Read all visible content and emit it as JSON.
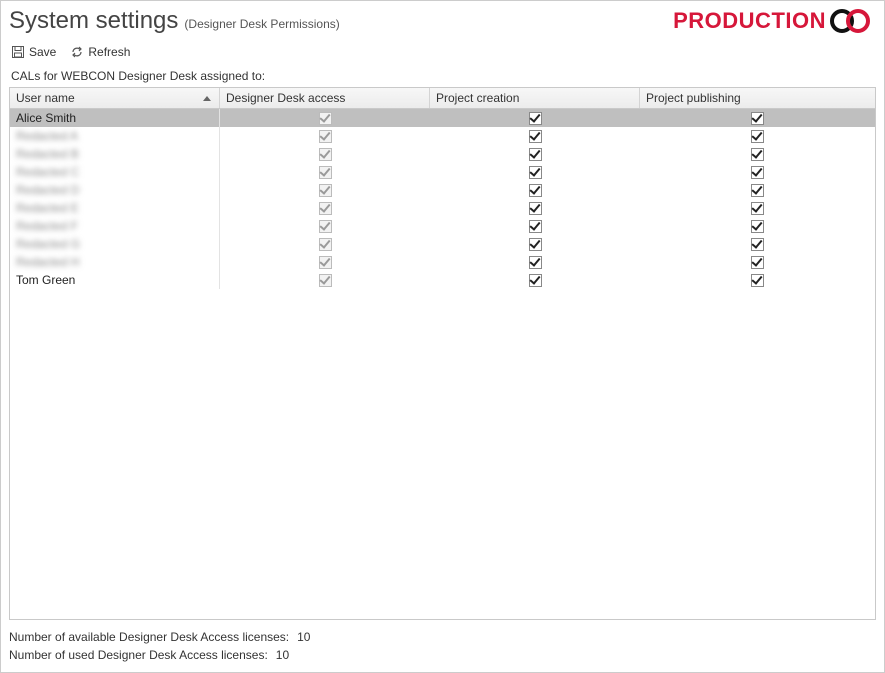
{
  "header": {
    "title": "System settings",
    "subtitle": "(Designer Desk Permissions)",
    "env_label": "PRODUCTION"
  },
  "toolbar": {
    "save_label": "Save",
    "refresh_label": "Refresh"
  },
  "section_label": "CALs for WEBCON Designer Desk assigned to:",
  "grid": {
    "columns": {
      "user": "User name",
      "access": "Designer Desk access",
      "create": "Project creation",
      "publish": "Project publishing"
    },
    "rows": [
      {
        "name": "Alice Smith",
        "blurred": false,
        "selected": true,
        "access": true,
        "create": true,
        "publish": true
      },
      {
        "name": "Redacted A",
        "blurred": true,
        "selected": false,
        "access": true,
        "create": true,
        "publish": true
      },
      {
        "name": "Redacted B",
        "blurred": true,
        "selected": false,
        "access": true,
        "create": true,
        "publish": true
      },
      {
        "name": "Redacted C",
        "blurred": true,
        "selected": false,
        "access": true,
        "create": true,
        "publish": true
      },
      {
        "name": "Redacted D",
        "blurred": true,
        "selected": false,
        "access": true,
        "create": true,
        "publish": true
      },
      {
        "name": "Redacted E",
        "blurred": true,
        "selected": false,
        "access": true,
        "create": true,
        "publish": true
      },
      {
        "name": "Redacted F",
        "blurred": true,
        "selected": false,
        "access": true,
        "create": true,
        "publish": true
      },
      {
        "name": "Redacted G",
        "blurred": true,
        "selected": false,
        "access": true,
        "create": true,
        "publish": true
      },
      {
        "name": "Redacted H",
        "blurred": true,
        "selected": false,
        "access": true,
        "create": true,
        "publish": true
      },
      {
        "name": "Tom Green",
        "blurred": false,
        "selected": false,
        "access": true,
        "create": true,
        "publish": true
      }
    ]
  },
  "footer": {
    "available_label": "Number of available Designer Desk Access licenses:",
    "available_value": "10",
    "used_label": "Number of used Designer Desk Access licenses:",
    "used_value": "10"
  }
}
